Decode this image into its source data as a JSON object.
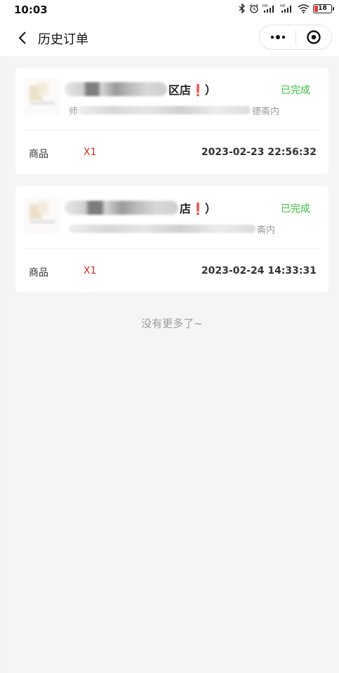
{
  "status_bar": {
    "time": "10:03",
    "battery": "18",
    "signal_1": "HD",
    "signal_2": "HD"
  },
  "nav": {
    "title": "历史订单"
  },
  "orders": [
    {
      "store_name_suffix": "区店",
      "exclaim": "❗",
      "paren": "）",
      "address_prefix": "师",
      "address_suffix": "德斋内",
      "status": "已完成",
      "goods_label": "商品",
      "quantity": "X1",
      "time": "2023-02-23 22:56:32"
    },
    {
      "store_name_suffix": "店",
      "exclaim": "❗",
      "paren": "）",
      "address_prefix": "",
      "address_suffix": "斋内",
      "status": "已完成",
      "goods_label": "商品",
      "quantity": "X1",
      "time": "2023-02-24 14:33:31"
    }
  ],
  "footer": {
    "end_text": "没有更多了~"
  },
  "colors": {
    "status_green": "#34c23a",
    "quantity_red": "#d32b2b",
    "accent_red": "#e0201e"
  }
}
